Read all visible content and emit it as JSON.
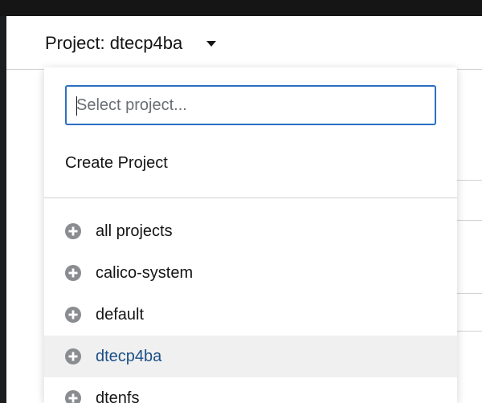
{
  "header": {
    "project_toggle_label": "Project: dtecp4ba"
  },
  "menu": {
    "search": {
      "placeholder": "Select project...",
      "value": ""
    },
    "create_project_label": "Create Project",
    "items": [
      {
        "label": "all projects",
        "selected": false
      },
      {
        "label": "calico-system",
        "selected": false
      },
      {
        "label": "default",
        "selected": false
      },
      {
        "label": "dtecp4ba",
        "selected": true
      },
      {
        "label": "dtenfs",
        "selected": false
      }
    ]
  },
  "colors": {
    "accent": "#2b6fc2",
    "selected_text": "#1c4f86",
    "selected_bg": "#f0f0f0",
    "icon_gray": "#8a8d90"
  },
  "icons": {
    "toggle": "caret-down-icon",
    "item": "plus-circle-icon"
  }
}
